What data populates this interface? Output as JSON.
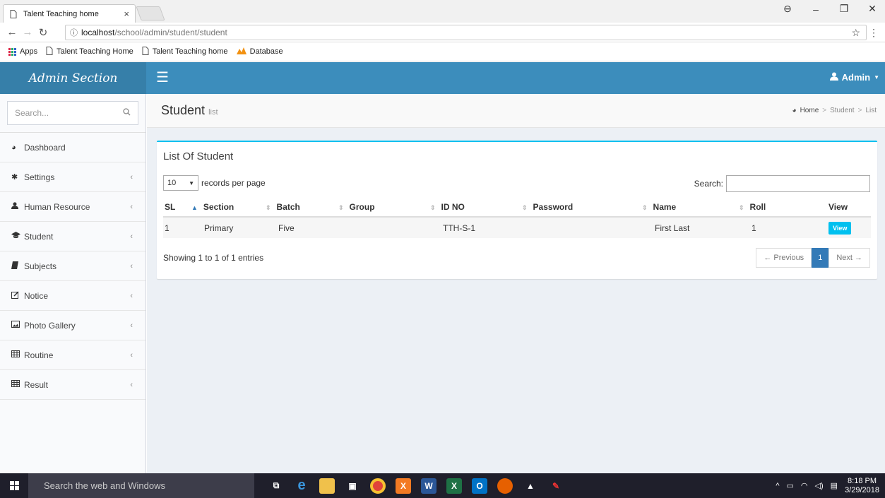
{
  "browser": {
    "tab_title": "Talent Teaching home",
    "tab_close": "×",
    "url_host": "localhost",
    "url_path": "/school/admin/student/student",
    "bookmarks": [
      "Apps",
      "Talent Teaching Home",
      "Talent Teaching home",
      "Database"
    ],
    "window_controls": [
      "⊖",
      "–",
      "❐",
      "✕"
    ]
  },
  "header": {
    "brand": "Admin Section",
    "user_label": "Admin"
  },
  "sidebar": {
    "search_placeholder": "Search...",
    "items": [
      {
        "label": "Dashboard",
        "icon": "dashboard-icon"
      },
      {
        "label": "Settings",
        "icon": "gear-icon"
      },
      {
        "label": "Human Resource",
        "icon": "user-icon"
      },
      {
        "label": "Student",
        "icon": "graduation-cap-icon"
      },
      {
        "label": "Subjects",
        "icon": "book-icon"
      },
      {
        "label": "Notice",
        "icon": "edit-icon"
      },
      {
        "label": "Photo Gallery",
        "icon": "image-icon"
      },
      {
        "label": "Routine",
        "icon": "table-icon"
      },
      {
        "label": "Result",
        "icon": "table-icon"
      }
    ]
  },
  "page": {
    "title": "Student",
    "subtitle": "list",
    "breadcrumb": [
      "Home",
      "Student",
      "List"
    ]
  },
  "box": {
    "title": "List Of Student",
    "page_length": "10",
    "records_label": "records per page",
    "search_label": "Search:",
    "columns": [
      "SL",
      "Section",
      "Batch",
      "Group",
      "ID NO",
      "Password",
      "Name",
      "Roll",
      "View"
    ],
    "rows": [
      {
        "sl": "1",
        "section": "Primary",
        "batch": "Five",
        "group": "",
        "id_no": "TTH-S-1",
        "password": "",
        "name": "First Last",
        "roll": "1",
        "view": "View"
      }
    ],
    "info": "Showing 1 to 1 of 1 entries",
    "pager": {
      "prev": "← Previous",
      "current": "1",
      "next": "Next →"
    }
  },
  "taskbar": {
    "search_placeholder": "Search the web and Windows",
    "time": "8:18 PM",
    "date": "3/29/2018"
  },
  "colors": {
    "topbar": "#3c8dbc",
    "brand": "#367fa9",
    "box_accent": "#00c0ef",
    "pager_active": "#337ab7"
  }
}
